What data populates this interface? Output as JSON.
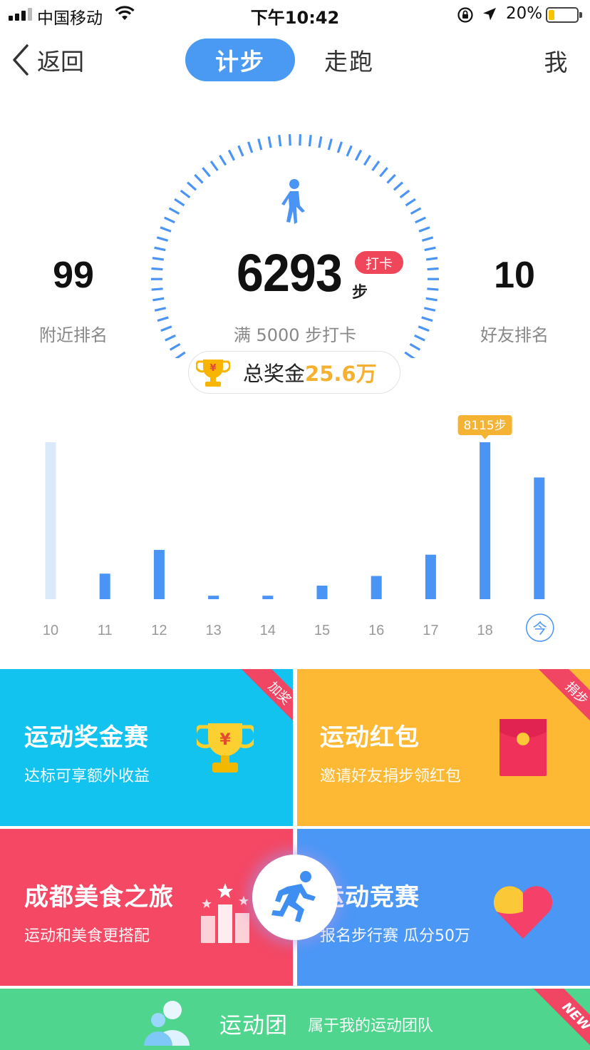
{
  "status_bar": {
    "carrier": "中国移动",
    "time": "下午10:42",
    "battery_percent": "20%",
    "battery_level": 0.2
  },
  "nav": {
    "back_label": "返回",
    "tabs": [
      {
        "label": "计步",
        "active": true
      },
      {
        "label": "走跑",
        "active": false
      }
    ],
    "me_label": "我"
  },
  "summary": {
    "steps": "6293",
    "steps_unit": "步",
    "checkin_label": "打卡",
    "goal_text": "满 5000 步打卡",
    "nearby_rank": "99",
    "nearby_rank_label": "附近排名",
    "friend_rank": "10",
    "friend_rank_label": "好友排名",
    "prize_label": "总奖金",
    "prize_amount": "25.6万"
  },
  "chart_data": {
    "type": "bar",
    "categories": [
      "10",
      "11",
      "12",
      "13",
      "14",
      "15",
      "16",
      "17",
      "18",
      "今"
    ],
    "values": [
      8115,
      1320,
      2550,
      180,
      180,
      700,
      1200,
      2300,
      8115,
      6293
    ],
    "faded_categories": [
      "10"
    ],
    "highlight": {
      "category": "18",
      "label": "8115步"
    },
    "ymax": 8115,
    "colors": {
      "bar": "#4a94f5",
      "faded_bar": "#dbeafb",
      "highlight_label": "#f5b334",
      "today_circle": "#4a94f5"
    }
  },
  "cards": [
    {
      "title": "运动奖金赛",
      "subtitle": "达标可享额外收益",
      "ribbon": "加奖",
      "color": "#12c3f0",
      "icon": "trophy-icon"
    },
    {
      "title": "运动红包",
      "subtitle": "邀请好友捐步领红包",
      "ribbon": "捐步",
      "color": "#fdb933",
      "icon": "red-envelope-icon"
    },
    {
      "title": "成都美食之旅",
      "subtitle": "运动和美食更搭配",
      "color": "#f44865",
      "icon": "podium-icon"
    },
    {
      "title": "运动竞赛",
      "subtitle": "报名步行赛 瓜分50万",
      "color": "#4b97f6",
      "icon": "heart-icon"
    }
  ],
  "team_bar": {
    "title": "运动团",
    "subtitle": "属于我的运动团队",
    "ribbon": "NEW",
    "color": "#4fd58e",
    "icon": "group-avatar-icon"
  },
  "fab_icon": "running-man-icon"
}
